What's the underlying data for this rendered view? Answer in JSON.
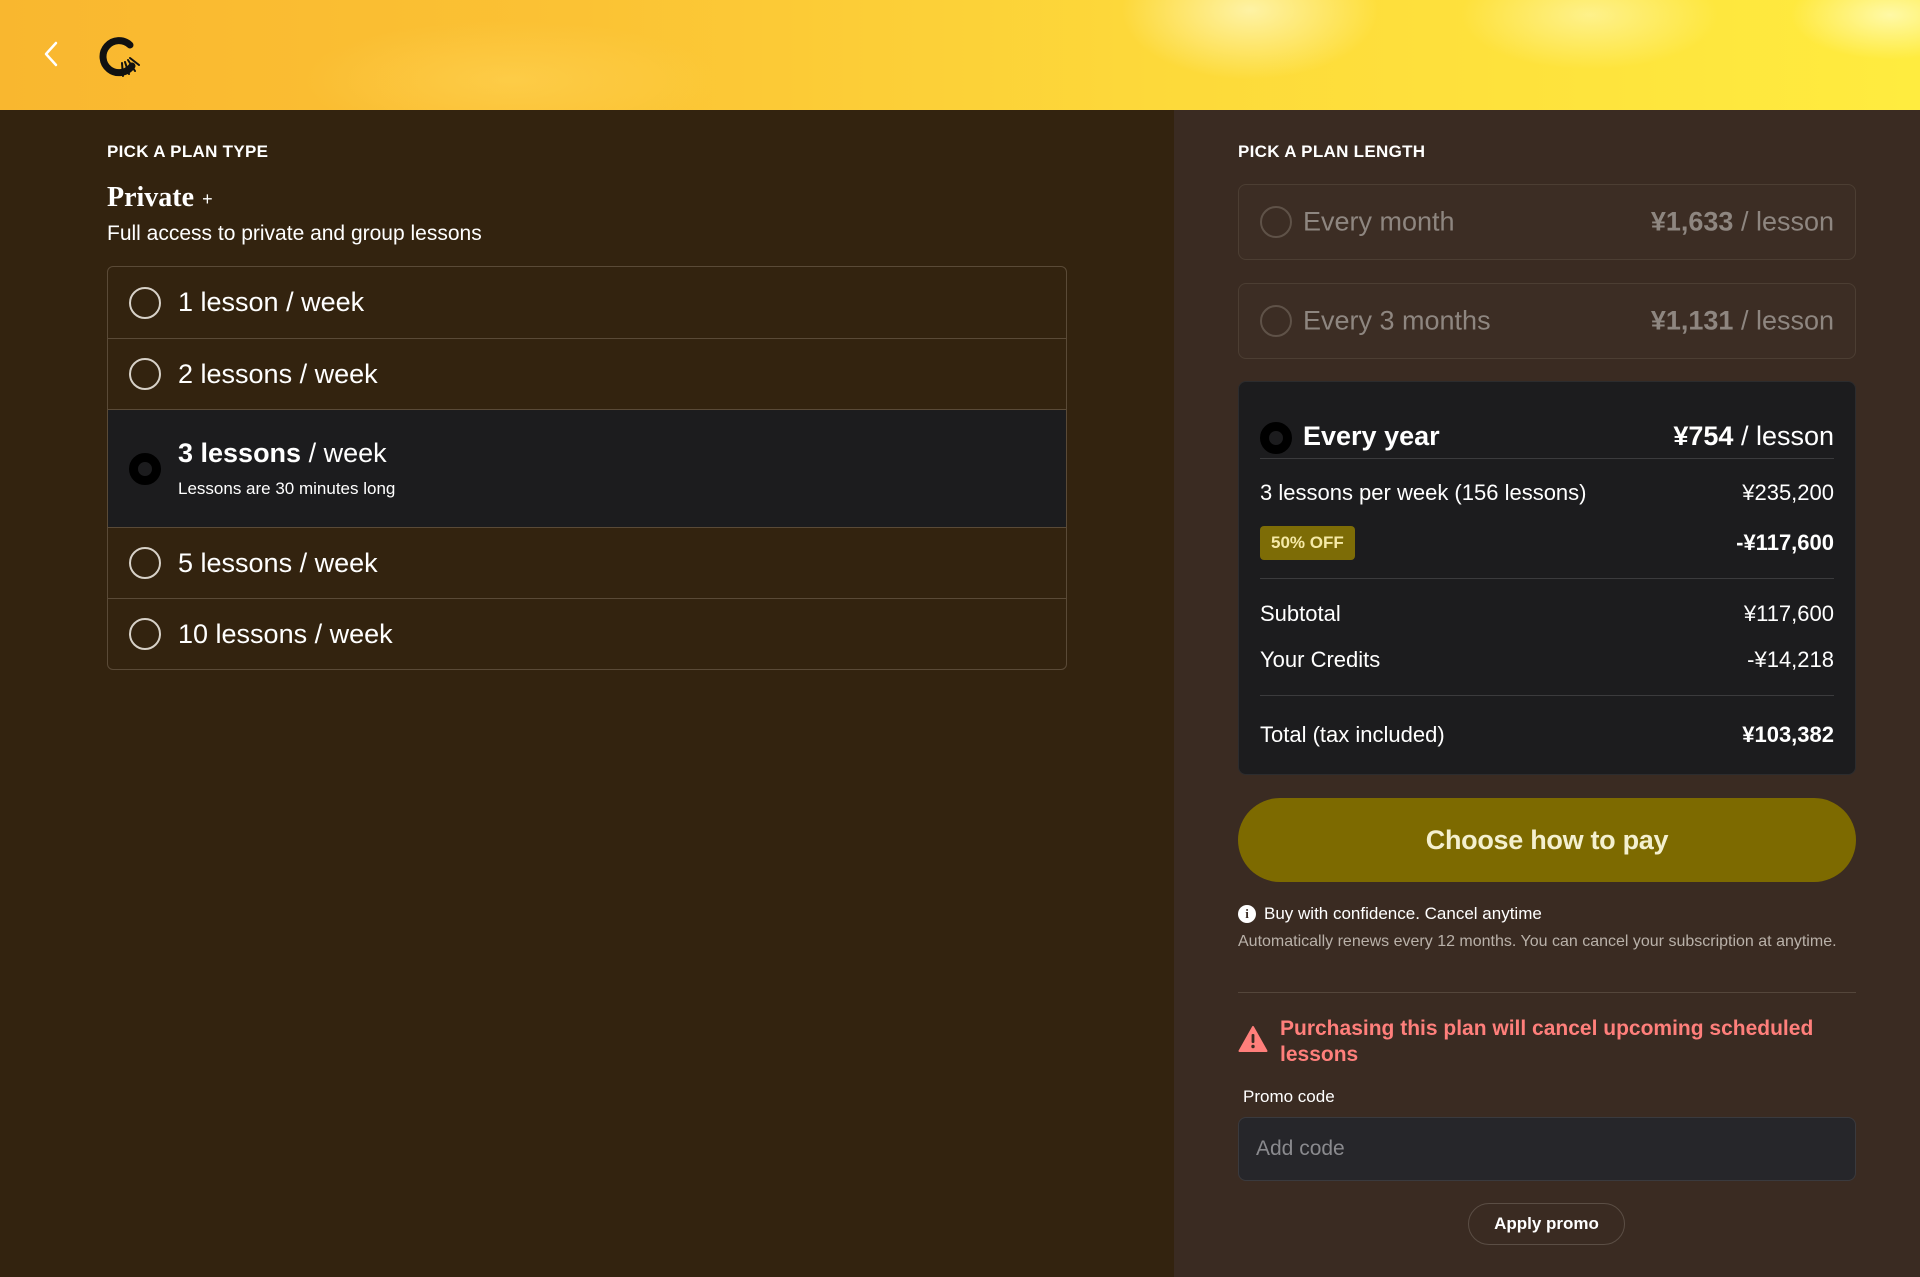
{
  "header": {
    "back_icon": "chevron-left-icon",
    "logo_icon": "app-logo-icon"
  },
  "plan_type": {
    "section_label": "PICK A PLAN TYPE",
    "name": "Private",
    "name_suffix": "+",
    "description": "Full access to private and group lessons",
    "options": [
      {
        "bold": "",
        "label": "1 lesson / week",
        "selected": false
      },
      {
        "bold": "",
        "label": "2 lessons / week",
        "selected": false
      },
      {
        "bold": "3 lessons",
        "label": " / week",
        "sub": "Lessons are 30 minutes long",
        "selected": true
      },
      {
        "bold": "",
        "label": "5 lessons / week",
        "selected": false
      },
      {
        "bold": "",
        "label": "10 lessons / week",
        "selected": false
      }
    ]
  },
  "plan_length": {
    "section_label": "PICK A PLAN LENGTH",
    "month": {
      "name": "Every month",
      "price": "¥1,633",
      "unit": " / lesson"
    },
    "three_months": {
      "name": "Every 3 months",
      "price": "¥1,131",
      "unit": " / lesson"
    },
    "year": {
      "name": "Every year",
      "price": "¥754",
      "unit": " / lesson",
      "lessons_label": "3 lessons per week (156 lessons)",
      "lessons_amount": "¥235,200",
      "discount_badge": "50% OFF",
      "discount_amount": "-¥117,600",
      "subtotal_label": "Subtotal",
      "subtotal_amount": "¥117,600",
      "credits_label": "Your Credits",
      "credits_amount": "-¥14,218",
      "total_label": "Total (tax included)",
      "total_amount": "¥103,382"
    }
  },
  "pay_button": "Choose how to pay",
  "confidence": {
    "icon": "info-icon",
    "title": "Buy with confidence. Cancel anytime",
    "detail": "Automatically renews every 12 months. You can cancel your subscription at anytime."
  },
  "warning": {
    "icon": "warning-triangle-icon",
    "text": "Purchasing this plan will cancel upcoming scheduled lessons"
  },
  "promo": {
    "label": "Promo code",
    "placeholder": "Add code",
    "value": "",
    "apply_label": "Apply promo"
  },
  "colors": {
    "left_bg": "#33230f",
    "right_bg": "#3a2b22",
    "card_dark": "#1c1c1e",
    "accent_olive": "#7d6a00",
    "warning": "#ff7f7b"
  }
}
